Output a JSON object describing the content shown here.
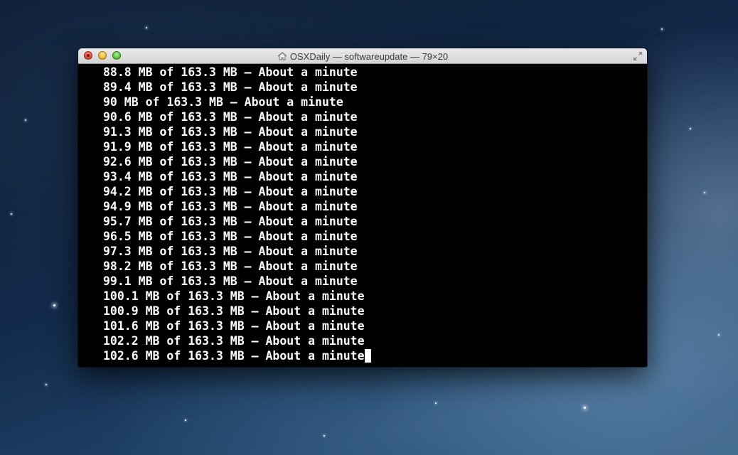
{
  "window": {
    "title": "OSXDaily — softwareupdate — 79×20"
  },
  "terminal": {
    "lines": [
      "88.8 MB of 163.3 MB — About a minute",
      "89.4 MB of 163.3 MB — About a minute",
      "90 MB of 163.3 MB — About a minute",
      "90.6 MB of 163.3 MB — About a minute",
      "91.3 MB of 163.3 MB — About a minute",
      "91.9 MB of 163.3 MB — About a minute",
      "92.6 MB of 163.3 MB — About a minute",
      "93.4 MB of 163.3 MB — About a minute",
      "94.2 MB of 163.3 MB — About a minute",
      "94.9 MB of 163.3 MB — About a minute",
      "95.7 MB of 163.3 MB — About a minute",
      "96.5 MB of 163.3 MB — About a minute",
      "97.3 MB of 163.3 MB — About a minute",
      "98.2 MB of 163.3 MB — About a minute",
      "99.1 MB of 163.3 MB — About a minute",
      "100.1 MB of 163.3 MB — About a minute",
      "100.9 MB of 163.3 MB — About a minute",
      "101.6 MB of 163.3 MB — About a minute",
      "102.2 MB of 163.3 MB — About a minute",
      "102.6 MB of 163.3 MB — About a minute"
    ]
  },
  "icons": {
    "title_icon": "home-icon",
    "fullscreen": "fullscreen-icon"
  },
  "colors": {
    "terminal_background": "#000000",
    "terminal_text": "#ffffff",
    "close": "#e2463b",
    "minimize": "#f3b92f",
    "zoom": "#5cc23f"
  }
}
